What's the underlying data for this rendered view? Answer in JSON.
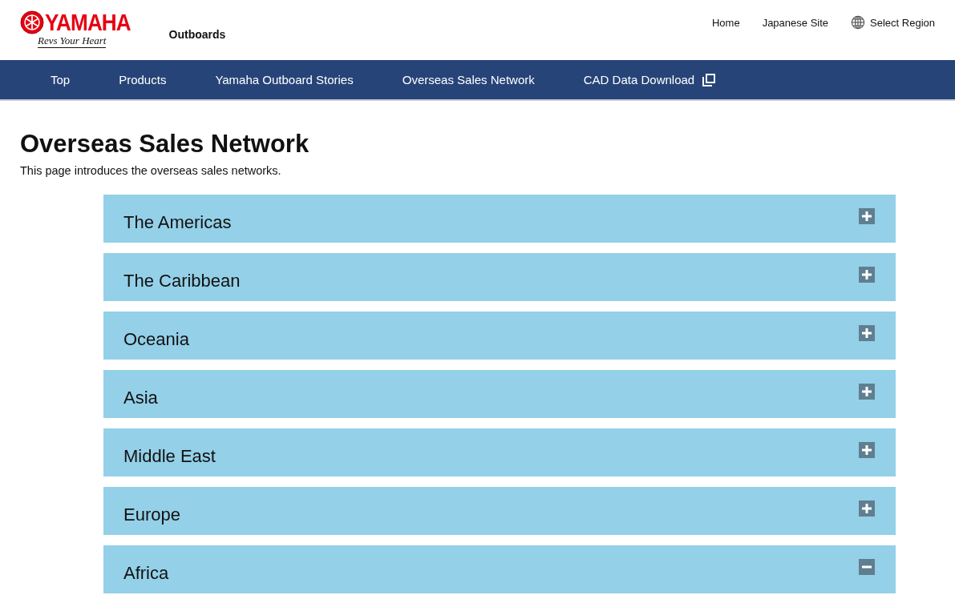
{
  "header": {
    "logo": {
      "brand": "YAMAHA",
      "tagline": "Revs Your Heart"
    },
    "site_name": "Outboards",
    "links": [
      {
        "label": "Home",
        "kind": "text"
      },
      {
        "label": "Japanese Site",
        "kind": "text"
      },
      {
        "label": "Select Region",
        "kind": "globe"
      }
    ]
  },
  "nav": [
    {
      "label": "Top",
      "external": false
    },
    {
      "label": "Products",
      "external": false
    },
    {
      "label": "Yamaha Outboard Stories",
      "external": false
    },
    {
      "label": "Overseas Sales Network",
      "external": false
    },
    {
      "label": "CAD Data Download",
      "external": true
    }
  ],
  "page": {
    "title": "Overseas Sales Network",
    "intro": "This page introduces the overseas sales networks."
  },
  "regions": [
    {
      "label": "The Americas",
      "expanded": false
    },
    {
      "label": "The Caribbean",
      "expanded": false
    },
    {
      "label": "Oceania",
      "expanded": false
    },
    {
      "label": "Asia",
      "expanded": false
    },
    {
      "label": "Middle East",
      "expanded": false
    },
    {
      "label": "Europe",
      "expanded": false
    },
    {
      "label": "Africa",
      "expanded": true
    }
  ]
}
